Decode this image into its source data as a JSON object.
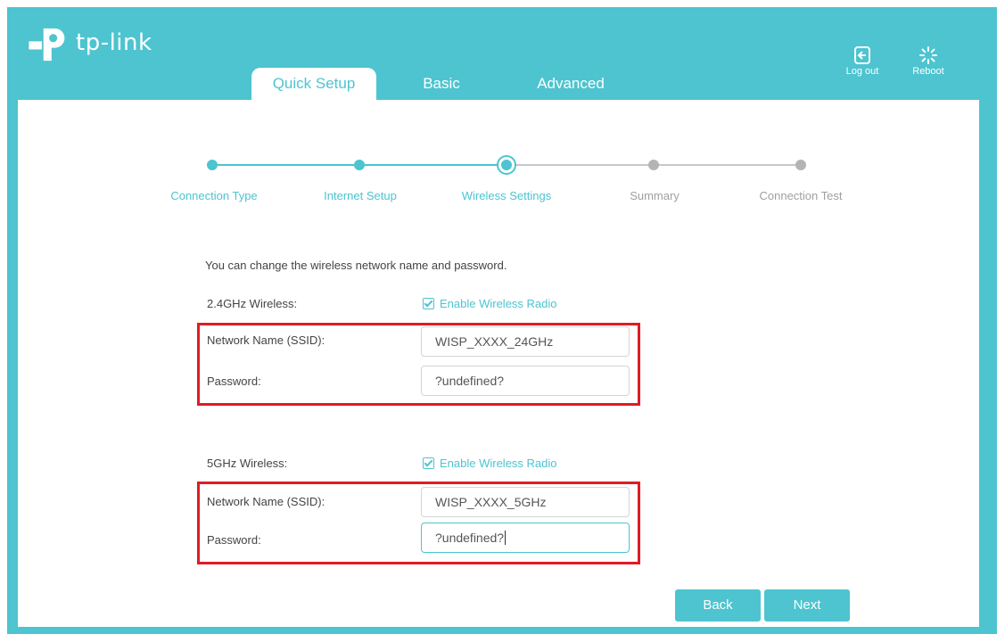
{
  "brand": {
    "name": "tp-link"
  },
  "nav": {
    "tabs": [
      {
        "label": "Quick Setup"
      },
      {
        "label": "Basic"
      },
      {
        "label": "Advanced"
      }
    ]
  },
  "actions": {
    "logout_label": "Log out",
    "reboot_label": "Reboot"
  },
  "steps": [
    {
      "label": "Connection Type",
      "state": "done"
    },
    {
      "label": "Internet Setup",
      "state": "done"
    },
    {
      "label": "Wireless Settings",
      "state": "current"
    },
    {
      "label": "Summary",
      "state": "pending"
    },
    {
      "label": "Connection Test",
      "state": "pending"
    }
  ],
  "intro": "You can change the wireless network name and password.",
  "wireless_24": {
    "title": "2.4GHz Wireless:",
    "enable_label": "Enable Wireless Radio",
    "enabled": true,
    "ssid_label": "Network Name (SSID):",
    "ssid_value": "WISP_XXXX_24GHz",
    "password_label": "Password:",
    "password_value": "?undefined?"
  },
  "wireless_5": {
    "title": "5GHz Wireless:",
    "enable_label": "Enable Wireless Radio",
    "enabled": true,
    "ssid_label": "Network Name (SSID):",
    "ssid_value": "WISP_XXXX_5GHz",
    "password_label": "Password:",
    "password_value": "?undefined?"
  },
  "buttons": {
    "back": "Back",
    "next": "Next"
  },
  "colors": {
    "accent": "#4dc4d0",
    "highlight": "#e01b24",
    "pending": "#a0a0a0"
  }
}
